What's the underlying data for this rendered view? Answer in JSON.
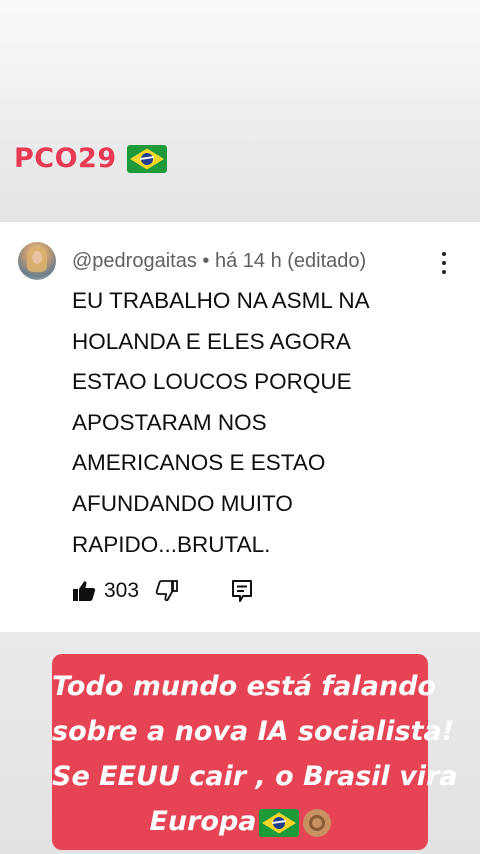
{
  "header": {
    "tag_text": "PCO29",
    "flag_icon": "brazil-flag-emoji",
    "tag_color": "#e83a55"
  },
  "comment": {
    "handle": "@pedrogaitas",
    "separator": "•",
    "time": "há 14 h",
    "edited": "(editado)",
    "text": "EU TRABALHO NA ASML NA\nHOLANDA E ELES AGORA\nESTAO LOUCOS PORQUE\nAPOSTARAM NOS\nAMERICANOS E  ESTAO\nAFUNDANDO MUITO\nRAPIDO...BRUTAL.",
    "like_count": "303",
    "icons": [
      "avatar",
      "more-options-icon",
      "thumbs-up-icon",
      "thumbs-down-icon",
      "reply-icon"
    ]
  },
  "caption": {
    "lines": [
      "Todo mundo está falando",
      "sobre a nova IA socialista!",
      "Se EEUU cair , o Brasil vira",
      "Europa"
    ],
    "emojis": [
      "brazil-flag-emoji",
      "ok-hand-icon"
    ],
    "background_color": "#e64455"
  }
}
